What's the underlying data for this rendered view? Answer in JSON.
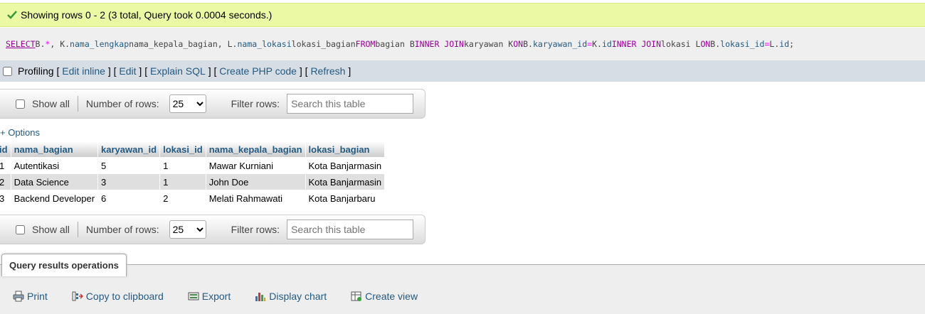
{
  "success": {
    "message": "Showing rows 0 - 2 (3 total, Query took 0.0004 seconds.)"
  },
  "sql": {
    "select": "SELECT",
    "p1": " B.",
    "star": "*",
    "p2": ", K.",
    "c1": "nama_lengkap",
    "p3": " nama_kepala_bagian, L.",
    "c2": "nama_lokasi",
    "p4": " lokasi_bagian ",
    "from": "FROM",
    "p5": " bagian B ",
    "join1": "INNER JOIN",
    "p6": " karyawan K ",
    "on1": "ON",
    "p7": " B.",
    "c3": "karyawan_id",
    "eq1": " = ",
    "p8": "K.",
    "c4": "id",
    "p9": " ",
    "join2": "INNER JOIN",
    "p10": " lokasi L ",
    "on2": "ON",
    "p11": " B.",
    "c5": "lokasi_id",
    "eq2": " = ",
    "p12": "L.",
    "c6": "id",
    "end": ";"
  },
  "profiling": {
    "label": "Profiling",
    "links": [
      "Edit inline",
      "Edit",
      "Explain SQL",
      "Create PHP code",
      "Refresh"
    ]
  },
  "navigation": {
    "show_all": "Show all",
    "rows_label": "Number of rows:",
    "rows_value": "25",
    "filter_label": "Filter rows:",
    "search_placeholder": "Search this table"
  },
  "options_link": "+ Options",
  "table": {
    "headers": [
      "id",
      "nama_bagian",
      "karyawan_id",
      "lokasi_id",
      "nama_kepala_bagian",
      "lokasi_bagian"
    ],
    "rows": [
      [
        "1",
        "Autentikasi",
        "5",
        "1",
        "Mawar Kurniani",
        "Kota Banjarmasin"
      ],
      [
        "2",
        "Data Science",
        "3",
        "1",
        "John Doe",
        "Kota Banjarmasin"
      ],
      [
        "3",
        "Backend Developer",
        "6",
        "2",
        "Melati Rahmawati",
        "Kota Banjarbaru"
      ]
    ]
  },
  "operations": {
    "title": "Query results operations",
    "links": [
      "Print",
      "Copy to clipboard",
      "Export",
      "Display chart",
      "Create view"
    ]
  },
  "colors": {
    "success_bg": "#ebf8a4",
    "link": "#235a81",
    "keyword": "#990099"
  }
}
